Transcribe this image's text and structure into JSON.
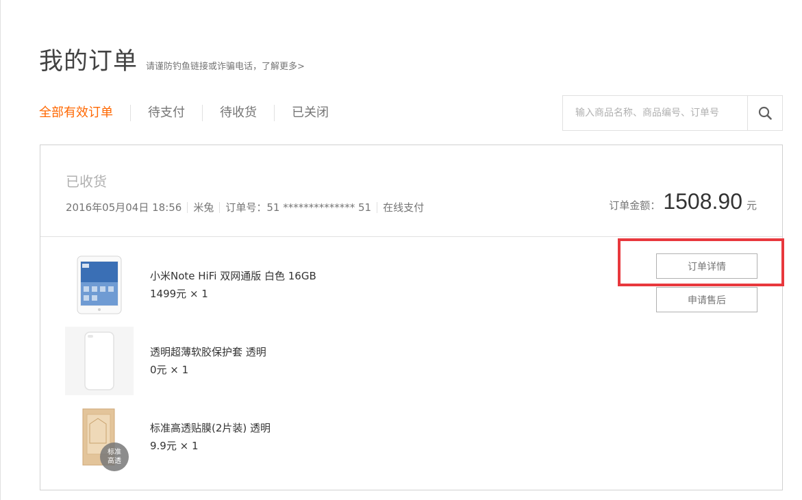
{
  "header": {
    "title": "我的订单",
    "note": "请谨防钓鱼链接或诈骗电话，",
    "note_link": "了解更多>"
  },
  "tabs": [
    {
      "label": "全部有效订单",
      "active": true
    },
    {
      "label": "待支付",
      "active": false
    },
    {
      "label": "待收货",
      "active": false
    },
    {
      "label": "已关闭",
      "active": false
    }
  ],
  "search": {
    "placeholder": "输入商品名称、商品编号、订单号",
    "icon": "search-icon"
  },
  "order": {
    "status": "已收货",
    "date": "2016年05月04日 18:56",
    "recipient": "米兔",
    "order_no_label": "订单号：",
    "order_no": "51 ************** 51",
    "payment": "在线支付",
    "total_label": "订单金额：",
    "total_value": "1508.90",
    "total_unit": "元",
    "actions": {
      "detail": "订单详情",
      "after_sale": "申请售后"
    },
    "items": [
      {
        "name": "小米Note HiFi 双网通版 白色 16GB",
        "price": "1499元 × 1",
        "icon": "phone-thumbnail"
      },
      {
        "name": "透明超薄软胶保护套 透明",
        "price": "0元 × 1",
        "icon": "case-thumbnail"
      },
      {
        "name": "标准高透贴膜(2片装) 透明",
        "price": "9.9元 × 1",
        "icon": "screen-film-thumbnail",
        "badge": [
          "标准",
          "高透"
        ]
      }
    ]
  },
  "colors": {
    "accent": "#ff6700",
    "highlight": "#e8383d"
  }
}
